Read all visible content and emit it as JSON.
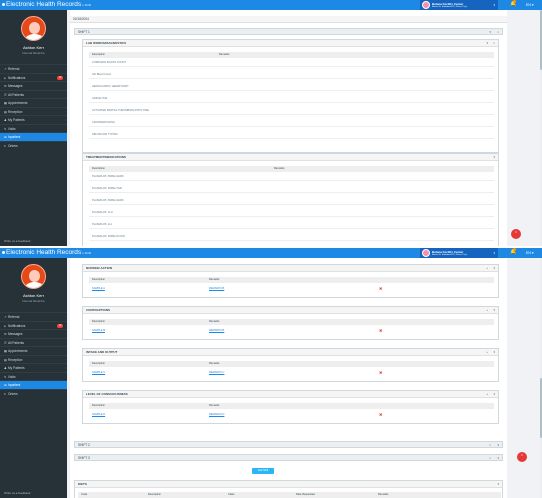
{
  "app": {
    "title": "Electronic Health Records",
    "version": "v. 40.32"
  },
  "facility": {
    "name": "Bulaca Facility Center",
    "address": "Barrio St. Sabadano 41, Pasco City...",
    "caret": "▾"
  },
  "header": {
    "language": "EN ▾",
    "bell": "🔔"
  },
  "user": {
    "name": "Ashton Kerr",
    "role": "Internal Medicine"
  },
  "nav": [
    {
      "label": "Referral",
      "icon": "↗",
      "count": ""
    },
    {
      "label": "Notifications",
      "icon": "●",
      "count": "10"
    },
    {
      "label": "Messages",
      "icon": "✉",
      "count": ""
    },
    {
      "label": "All Patients",
      "icon": "☰",
      "count": ""
    },
    {
      "label": "Appointments",
      "icon": "▦",
      "count": ""
    },
    {
      "label": "Reception",
      "icon": "▤",
      "count": ""
    },
    {
      "label": "My Patients",
      "icon": "♟",
      "count": ""
    },
    {
      "label": "Visits",
      "icon": "✎",
      "count": ""
    },
    {
      "label": "Inpatient",
      "icon": "⊞",
      "count": ""
    },
    {
      "label": "Orders",
      "icon": "≡",
      "count": ""
    }
  ],
  "feedback": "Write us a feedback",
  "date_header": "02/18/2024",
  "shift1": {
    "label": "SHIFT 1",
    "ctrl1": "▾",
    "ctrl2": "×"
  },
  "labs": {
    "title": "LAB WORKS/DIAGNOSTICS",
    "col_description": "Description",
    "col_remarks": "Remarks",
    "rows": [
      "COMPLETE BLOOD COUNT",
      "Hb/ Blood Count",
      "HEMOGLOBIN / HEMATOCRIT",
      "URINALYSIS",
      "ACTIVATED PARTIAL THROMBOPLASTIN TIME",
      "CROSSMATCHING",
      "ABO BLOOD TYPING"
    ]
  },
  "meds": {
    "title": "TREATMENT/MEDICATIONS",
    "col_description": "Description",
    "col_remarks": "Remarks",
    "rows": [
      "PLASMA D5, 500ML/4HRS",
      "PLASMA D5, 500ML/7HR",
      "PLASMA D5, 500ML/4HRS",
      "PLASMA D5, 1LH",
      "PLASMA D5, 1LJ",
      "PLASMA D5, 500ML/X2 D/D"
    ]
  },
  "nursing": {
    "title": "NURSING ACTION",
    "col_description": "Description",
    "col_remarks": "Remarks",
    "row": {
      "description": "SAMPLE A",
      "remarks": "REMARKS B"
    }
  },
  "contraptions": {
    "title": "CONTRAPTIONS",
    "col_description": "Description",
    "col_remarks": "Remarks",
    "row": {
      "description": "SAMPLE B",
      "remarks": "REMARKS B"
    }
  },
  "intake": {
    "title": "INTAKE AND OUTPUT",
    "col_description": "Description",
    "col_remarks": "Remarks",
    "row": {
      "description": "SAMPLE C",
      "remarks": "REMARKS C"
    }
  },
  "consciousness": {
    "title": "LEVEL OF CONSCIOUSNESS",
    "col_description": "Description",
    "col_remarks": "Remarks",
    "row": {
      "description": "SAMPLE D",
      "remarks": "REMARKS D"
    }
  },
  "delete_glyph": "✖",
  "ctrl_plus": "+",
  "ctrl_caret": "▾",
  "ctrl_close": "×",
  "shift2": {
    "label": "SHIFT 2"
  },
  "shift3": {
    "label": "SHIFT 3"
  },
  "add_shift": "Add Shift",
  "diets": {
    "title": "DIETS",
    "cols": [
      "Code",
      "Description",
      "Class",
      "Date Requested",
      "Remarks"
    ]
  },
  "fab": "⌃",
  "colors": {
    "brand": "#1e88e5",
    "sidebar": "#263238",
    "danger": "#e53935",
    "accent_button": "#29b6f6"
  }
}
